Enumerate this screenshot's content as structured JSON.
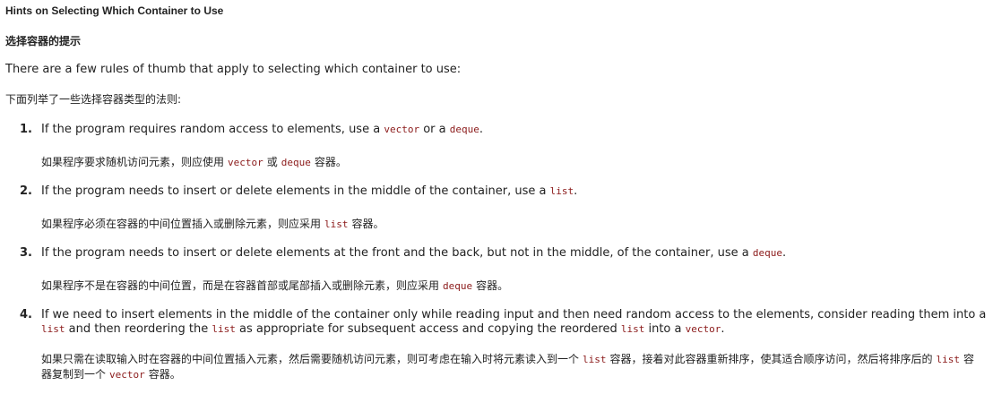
{
  "heading": "Hints on Selecting Which Container to Use",
  "heading_zh": "选择容器的提示",
  "intro": "There are a few rules of thumb that apply to selecting which container to use:",
  "intro_zh": "下面列举了一些选择容器类型的法则:",
  "items": [
    {
      "number": "1.",
      "en": {
        "t1": "If the program requires random access to elements, use a ",
        "c1": "vector",
        "t2": " or a ",
        "c2": "deque",
        "t3": "."
      },
      "zh": {
        "t1": "如果程序要求随机访问元素，则应使用",
        "c1": "vector",
        "t2": "或",
        "c2": "deque",
        "t3": "容器。"
      }
    },
    {
      "number": "2.",
      "en": {
        "t1": "If the program needs to insert or delete elements in the middle of the container, use a ",
        "c1": "list",
        "t2": "."
      },
      "zh": {
        "t1": "如果程序必须在容器的中间位置插入或删除元素，则应采用",
        "c1": "list",
        "t2": "容器。"
      }
    },
    {
      "number": "3.",
      "en": {
        "t1": "If the program needs to insert or delete elements at the front and the back, but not in the middle, of the container, use a ",
        "c1": "deque",
        "t2": "."
      },
      "zh": {
        "t1": "如果程序不是在容器的中间位置，而是在容器首部或尾部插入或删除元素，则应采用",
        "c1": "deque",
        "t2": "容器。"
      }
    },
    {
      "number": "4.",
      "en": {
        "t1": "If we need to insert elements in the middle of the container only while reading input and then need random access to the elements, consider reading them into a ",
        "c1": "list",
        "t2": " and then reordering the ",
        "c2": "list",
        "t3": " as appropriate for subsequent access and copying the reordered ",
        "c3": "list",
        "t4": " into a ",
        "c4": "vector",
        "t5": "."
      },
      "zh": {
        "t1": "如果只需在读取输入时在容器的中间位置插入元素，然后需要随机访问元素，则可考虑在输入时将元素读入到一个",
        "c1": "list",
        "t2": "容器，接着对此容器重新排序，使其适合顺序访问，然后将排序后的",
        "c2": "list",
        "t3": "容器复制到一个",
        "c3": "vector",
        "t4": "容器。"
      }
    }
  ]
}
